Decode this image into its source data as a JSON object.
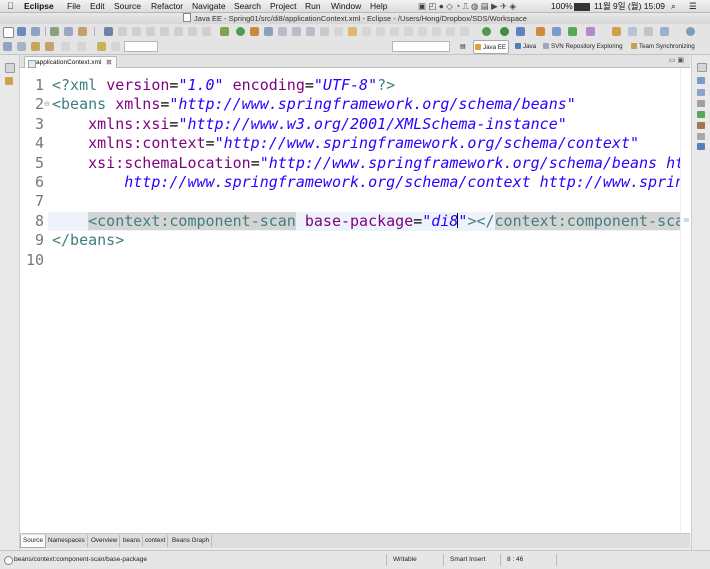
{
  "menubar": {
    "apple": "",
    "app_name": "Eclipse",
    "items": [
      "File",
      "Edit",
      "Source",
      "Refactor",
      "Navigate",
      "Search",
      "Project",
      "Run",
      "Window",
      "Help"
    ],
    "battery": "100%",
    "datetime": "11월 9일 (월)  15:09"
  },
  "window": {
    "title": "Java EE - Spring01/src/di8/applicationContext.xml - Eclipse - /Users/Hong/Dropbox/SDS/Workspace"
  },
  "perspectives": [
    {
      "label": "Java EE",
      "active": true
    },
    {
      "label": "Java",
      "active": false
    },
    {
      "label": "SVN Repository Exploring",
      "active": false
    },
    {
      "label": "Team Synchronizing",
      "active": false
    }
  ],
  "editor": {
    "tab_label": "applicationContext.xml",
    "tab_close": "⊠",
    "line_numbers": [
      "1",
      "2",
      "3",
      "4",
      "5",
      "6",
      "7",
      "8",
      "9",
      "10"
    ],
    "lines": {
      "l1": {
        "a": "<?xml ",
        "b": "version",
        "c": "=",
        "d": "\"1.0\"",
        "e": " ",
        "f": "encoding",
        "g": "=",
        "h": "\"UTF-8\"",
        "i": "?>"
      },
      "l2": {
        "a": "<beans ",
        "b": "xmlns",
        "c": "=",
        "d": "\"http://www.springframework.org/schema/beans\""
      },
      "l3": {
        "a": "    ",
        "b": "xmlns:xsi",
        "c": "=",
        "d": "\"http://www.w3.org/2001/XMLSchema-instance\""
      },
      "l4": {
        "a": "    ",
        "b": "xmlns:context",
        "c": "=",
        "d": "\"http://www.springframework.org/schema/context\""
      },
      "l5": {
        "a": "    ",
        "b": "xsi:schemaLocation",
        "c": "=",
        "d": "\"http://www.springframework.org/schema/beans http://www.springframework.org/schema/beans/spring-beans.xsd"
      },
      "l6": {
        "a": "        ",
        "d": "http://www.springframework.org/schema/context http://www.springframework.org/schema/context/spring-context.xsd\">"
      },
      "l8": {
        "a": "    ",
        "b": "<context:component-scan",
        "c": " ",
        "d": "base-package",
        "e": "=",
        "f": "\"di8",
        "g": "\"",
        "h": "></",
        "i": "context:component-scan",
        "j": ">"
      },
      "l9": {
        "a": "</beans>"
      }
    }
  },
  "bottom_tabs": [
    "Source",
    "Namespaces",
    "Overview",
    "beans",
    "context",
    "Beans Graph"
  ],
  "status": {
    "path": "beans/context:component-scan/base-package",
    "mode": "Writable",
    "insert": "Smart Insert",
    "position": "8 : 46"
  }
}
